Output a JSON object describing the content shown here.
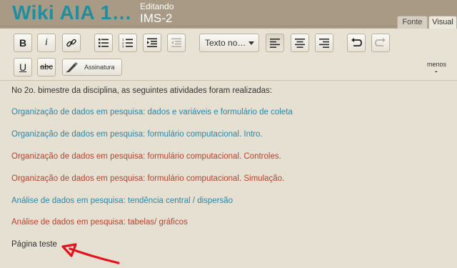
{
  "header": {
    "wiki_title": "Wiki AIA 1…",
    "editing_label": "Editando",
    "page_name": "IMS-2",
    "tabs": [
      {
        "label": "Fonte"
      },
      {
        "label": "Visual"
      }
    ]
  },
  "toolbar": {
    "bold_label": "B",
    "italic_label": "i",
    "format_select": "Texto no…",
    "underline_label": "U",
    "strike_label": "abc",
    "signature_label": "Assinatura",
    "less_label": "menos",
    "less_symbol": "-"
  },
  "content": {
    "lines": [
      {
        "text": "No 2o. bimestre da disciplina, as seguintes atividades foram realizadas:",
        "color": "#333333"
      },
      {
        "text": "Organização de dados em pesquisa: dados e variáveis e formulário de coleta",
        "color": "#2b86a4"
      },
      {
        "text": "Organização de dados em pesquisa: formulário computacional. Intro.",
        "color": "#2b86a4"
      },
      {
        "text": "Organização de dados em pesquisa: formulário computacional. Controles.",
        "color": "#b8432e"
      },
      {
        "text": "Organização de dados em pesquisa: formulário computacional. Simulação.",
        "color": "#b8432e"
      },
      {
        "text": "Análise de dados em pesquisa: tendência central / dispersão",
        "color": "#2b86a4"
      },
      {
        "text": "Análise de dados em pesquisa: tabelas/ gráficos",
        "color": "#b8432e"
      },
      {
        "text": "Página teste",
        "color": "#333333"
      }
    ]
  },
  "colors": {
    "header_bg": "#a89a84",
    "title": "#1d8fa0",
    "link_blue": "#2b86a4",
    "link_red": "#b8432e",
    "annotation_arrow": "#e8101a"
  },
  "icons": [
    "link-icon",
    "bullet-list-icon",
    "numbered-list-icon",
    "indent-icon",
    "outdent-icon",
    "align-left-icon",
    "align-center-icon",
    "align-right-icon",
    "undo-icon",
    "redo-icon",
    "signature-pen-icon",
    "red-arrow-annotation"
  ]
}
